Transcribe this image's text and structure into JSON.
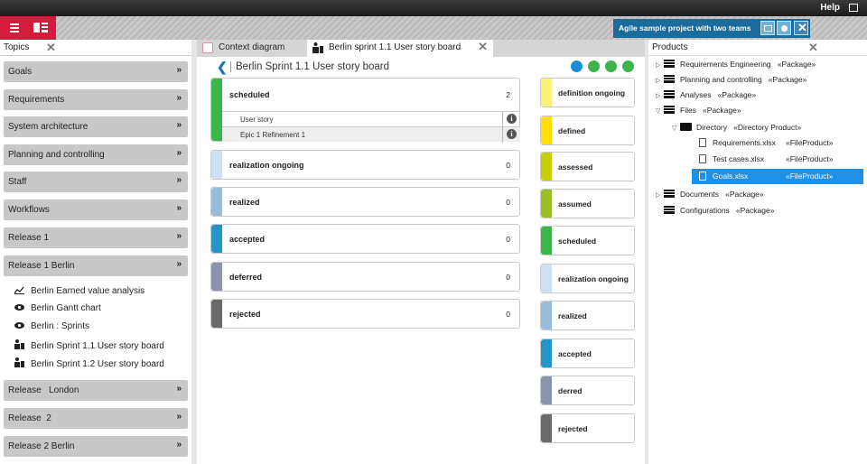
{
  "topbar": {
    "help": "Help"
  },
  "project": {
    "title": "Agile sample project with two teams"
  },
  "left_panel": {
    "title": "Topics",
    "topics": [
      {
        "label": "Goals"
      },
      {
        "label": "Requirements"
      },
      {
        "label": "System architecture"
      },
      {
        "label": "Planning and controlling"
      },
      {
        "label": "Staff"
      },
      {
        "label": "Workflows"
      },
      {
        "label": "Release 1"
      },
      {
        "label": "Release 1 Berlin"
      }
    ],
    "release1_berlin_items": [
      {
        "label": "Berlin Earned value analysis",
        "icon": "chart-icon"
      },
      {
        "label": "Berlin Gantt chart",
        "icon": "eye-icon"
      },
      {
        "label": "Berlin : Sprints",
        "icon": "eye-icon"
      },
      {
        "label": "Berlin Sprint 1.1 User story board",
        "icon": "board-icon"
      },
      {
        "label": "Berlin Sprint 1.2 User story board",
        "icon": "board-icon"
      }
    ],
    "topics_after": [
      {
        "label": "Release   London"
      },
      {
        "label": "Release  2"
      },
      {
        "label": "Release 2 Berlin"
      }
    ]
  },
  "center": {
    "tabs": [
      {
        "label": "Context diagram"
      },
      {
        "label": "Berlin sprint 1.1 User story board"
      }
    ],
    "board_title": "Berlin Sprint 1.1 User story board",
    "status_cards": [
      {
        "label": "scheduled",
        "count": "2",
        "color": "#3cb54a",
        "rows": [
          {
            "label": "User story"
          },
          {
            "label": "Epic 1 Refinement 1"
          }
        ]
      },
      {
        "label": "realization ongoing",
        "count": "0",
        "color": "#cfe0f0"
      },
      {
        "label": "realized",
        "count": "0",
        "color": "#99bcd9"
      },
      {
        "label": "accepted",
        "count": "0",
        "color": "#2594c7"
      },
      {
        "label": "deferred",
        "count": "0",
        "color": "#8a94aa"
      },
      {
        "label": "rejected",
        "count": "0",
        "color": "#6a6a6a"
      }
    ],
    "legend_cards": [
      {
        "label": "definition ongoing",
        "color": "#fff176"
      },
      {
        "label": "defined",
        "color": "#ffe000"
      },
      {
        "label": "assessed",
        "color": "#c6d000"
      },
      {
        "label": "assumed",
        "color": "#9bbf22"
      },
      {
        "label": "scheduled",
        "color": "#3cb54a"
      },
      {
        "label": "realization ongoing",
        "color": "#cfe0f0"
      },
      {
        "label": "realized",
        "color": "#99bcd9"
      },
      {
        "label": "accepted",
        "color": "#2594c7"
      },
      {
        "label": "derred",
        "color": "#8a94aa"
      },
      {
        "label": "rejected",
        "color": "#6a6a6a"
      }
    ]
  },
  "right_panel": {
    "title": "Products",
    "tree": [
      {
        "label": "Requirements Engineering",
        "stereo": "«Package»"
      },
      {
        "label": "Planning and controlling",
        "stereo": "«Package»"
      },
      {
        "label": "Analyses",
        "stereo": "«Package»"
      },
      {
        "label": "Files",
        "stereo": "«Package»"
      },
      {
        "label": "Directory",
        "stereo": "«Directory Product»"
      },
      {
        "label": "Requirements.xlsx",
        "stereo": "«FileProduct»"
      },
      {
        "label": "Test cases.xlsx",
        "stereo": "«FileProduct»"
      },
      {
        "label": "Goals.xlsx",
        "stereo": "«FileProduct»"
      },
      {
        "label": "Documents",
        "stereo": "«Package»"
      },
      {
        "label": "Configurations",
        "stereo": "«Package»"
      }
    ]
  },
  "colors": {
    "accent_red": "#d41b3c",
    "project_blue": "#1b6c9c",
    "selection_blue": "#1e90e6"
  }
}
